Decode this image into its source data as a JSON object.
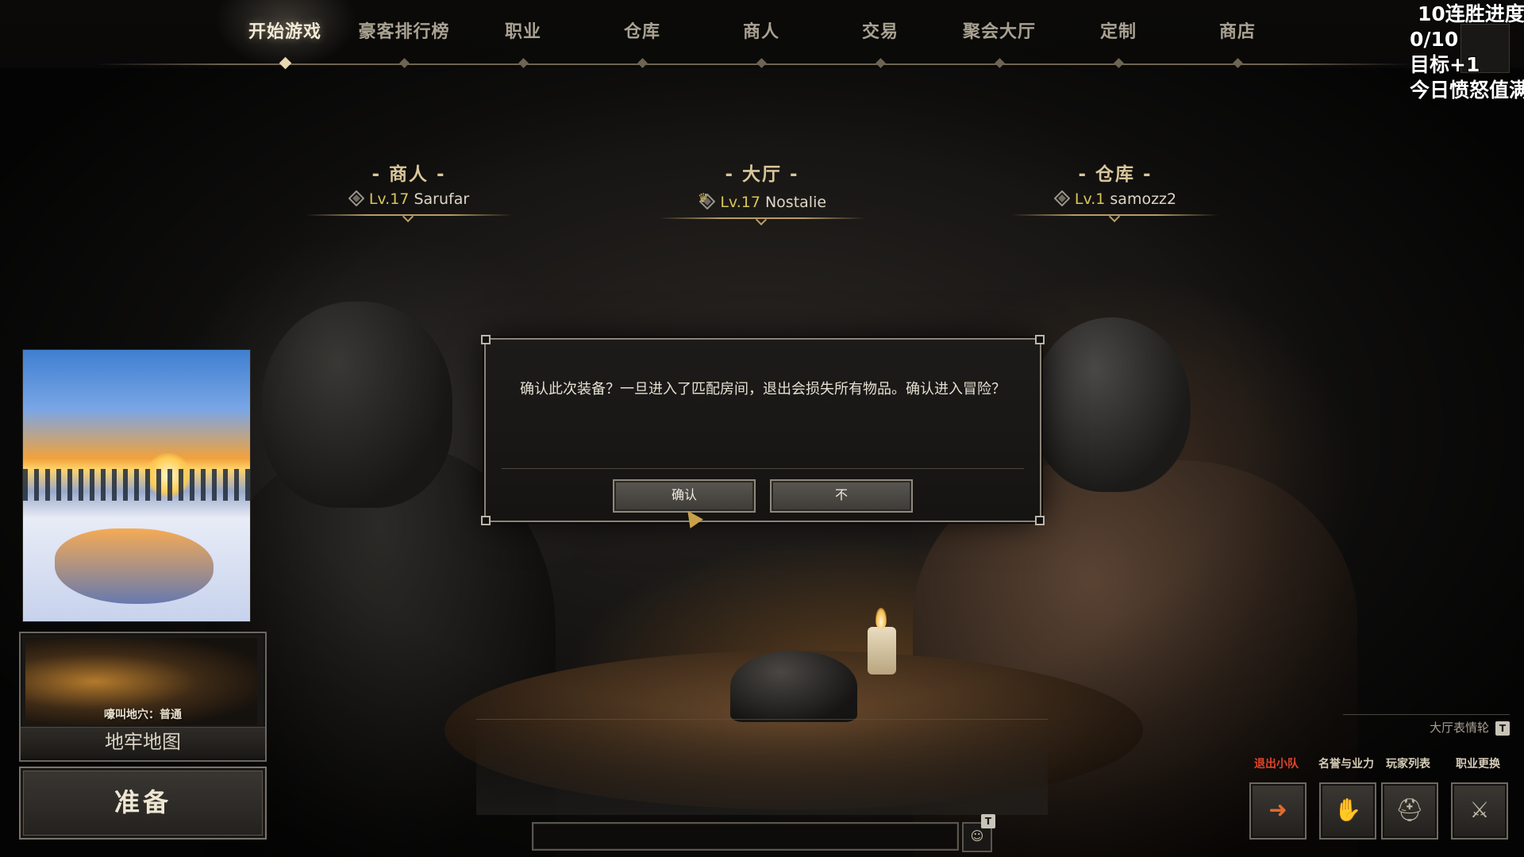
{
  "nav": {
    "items": [
      {
        "label": "开始游戏",
        "active": true
      },
      {
        "label": "豪客排行榜",
        "active": false
      },
      {
        "label": "职业",
        "active": false
      },
      {
        "label": "仓库",
        "active": false
      },
      {
        "label": "商人",
        "active": false
      },
      {
        "label": "交易",
        "active": false
      },
      {
        "label": "聚会大厅",
        "active": false
      },
      {
        "label": "定制",
        "active": false
      },
      {
        "label": "商店",
        "active": false
      }
    ]
  },
  "streak": {
    "title": "10连胜进度",
    "progress": "0/10",
    "goal": "目标+1",
    "note": "今日愤怒值满"
  },
  "party": [
    {
      "role": "- 商人 -",
      "level": "Lv.17",
      "name": "Sarufar",
      "leader": false
    },
    {
      "role": "- 大厅 -",
      "level": "Lv.17",
      "name": "Nostalie",
      "leader": true
    },
    {
      "role": "- 仓库 -",
      "level": "Lv.1",
      "name": "samozz2",
      "leader": false
    }
  ],
  "dungeon": {
    "subtitle": "嚎叫地穴：普通",
    "title": "地牢地图"
  },
  "ready_label": "准备",
  "modal": {
    "message": "确认此次装备？一旦进入了匹配房间，退出会损失所有物品。确认进入冒险？",
    "confirm_label": "确认",
    "cancel_label": "不"
  },
  "chat": {
    "input_value": "",
    "emoji_key": "T"
  },
  "emote_wheel": {
    "label": "大厅表情轮",
    "key": "T"
  },
  "actions": [
    {
      "label": "退出小队",
      "icon": "exit-icon",
      "color": "#e0442c"
    },
    {
      "label": "名誉与业力",
      "icon": "thumbs-icon",
      "color": "#d6cdb8"
    },
    {
      "label": "玩家列表",
      "icon": "helmet-icon",
      "color": "#d6cdb8"
    },
    {
      "label": "职业更换",
      "icon": "class-swap-icon",
      "color": "#d6cdb8"
    }
  ],
  "colors": {
    "level": "#d8c55a",
    "exit_red": "#e0442c"
  }
}
